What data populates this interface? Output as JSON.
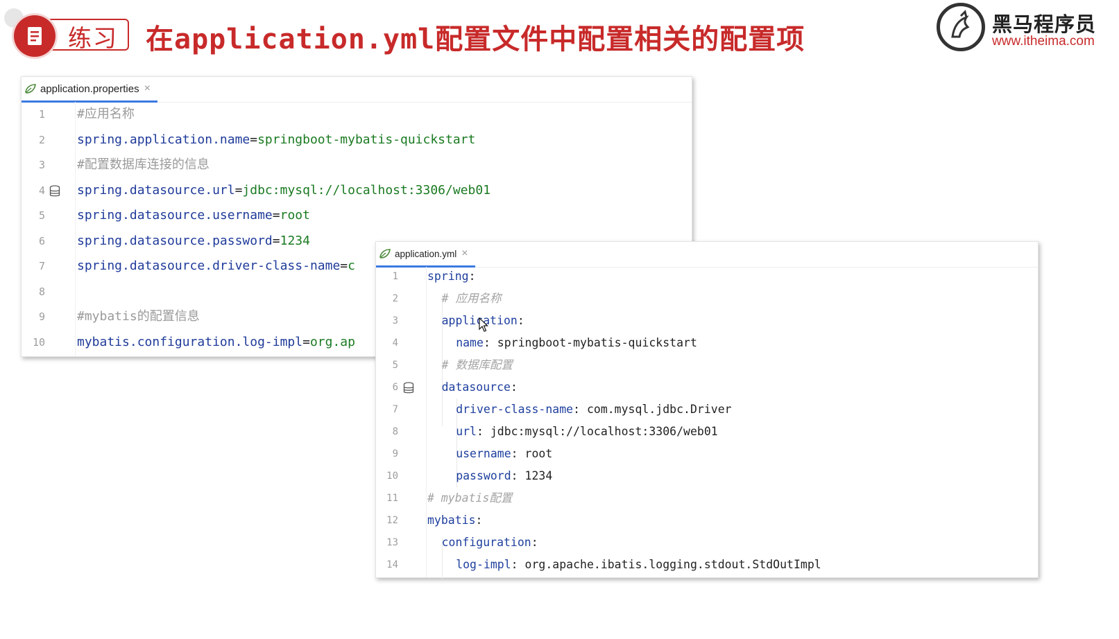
{
  "header": {
    "badge_label": "练习",
    "title": "在application.yml配置文件中配置相关的配置项"
  },
  "logo": {
    "name": "黑马程序员",
    "url": "www.itheima.com"
  },
  "properties_editor": {
    "tab": {
      "label": "application.properties",
      "close": "×"
    },
    "lines": [
      {
        "n": "1",
        "comment": "#应用名称"
      },
      {
        "n": "2",
        "key": "spring.application.name",
        "sep": "=",
        "value": "springboot-mybatis-quickstart"
      },
      {
        "n": "3",
        "comment": "#配置数据库连接的信息"
      },
      {
        "n": "4",
        "key": "spring.datasource.url",
        "sep": "=",
        "value": "jdbc:mysql://localhost:3306/web01"
      },
      {
        "n": "5",
        "key": "spring.datasource.username",
        "sep": "=",
        "value": "root"
      },
      {
        "n": "6",
        "key": "spring.datasource.password",
        "sep": "=",
        "value": "1234"
      },
      {
        "n": "7",
        "key": "spring.datasource.driver-class-name",
        "sep": "=",
        "value": "c"
      },
      {
        "n": "8"
      },
      {
        "n": "9",
        "comment": "#mybatis的配置信息"
      },
      {
        "n": "10",
        "key": "mybatis.configuration.log-impl",
        "sep": "=",
        "value": "org.ap"
      }
    ]
  },
  "yml_editor": {
    "tab": {
      "label": "application.yml",
      "close": "×"
    },
    "lines": [
      {
        "n": "1",
        "key": "spring",
        "sep": ":"
      },
      {
        "n": "2",
        "comment": "# 应用名称"
      },
      {
        "n": "3",
        "key": "application",
        "sep": ":"
      },
      {
        "n": "4",
        "key": "name",
        "sep": ":",
        "value": " springboot-mybatis-quickstart"
      },
      {
        "n": "5",
        "comment": "# 数据库配置"
      },
      {
        "n": "6",
        "key": "datasource",
        "sep": ":"
      },
      {
        "n": "7",
        "key": "driver-class-name",
        "sep": ":",
        "value": " com.mysql.jdbc.Driver"
      },
      {
        "n": "8",
        "key": "url",
        "sep": ":",
        "value": " jdbc:mysql://localhost:3306/web01"
      },
      {
        "n": "9",
        "key": "username",
        "sep": ":",
        "value": " root"
      },
      {
        "n": "10",
        "key": "password",
        "sep": ":",
        "value": " 1234"
      },
      {
        "n": "11",
        "comment": "# mybatis配置"
      },
      {
        "n": "12",
        "key": "mybatis",
        "sep": ":"
      },
      {
        "n": "13",
        "key": "configuration",
        "sep": ":"
      },
      {
        "n": "14",
        "key": "log-impl",
        "sep": ":",
        "value": " org.apache.ibatis.logging.stdout.StdOutImpl"
      }
    ]
  },
  "colors": {
    "accent_red": "#c82a2a",
    "tab_underline": "#3b79e0",
    "key": "#1f3b9a",
    "value_green": "#1a7a21",
    "comment": "#9a9a9a"
  },
  "icons": [
    "document-icon",
    "spring-leaf-icon",
    "database-icon",
    "close-icon",
    "mouse-cursor-icon",
    "horse-logo-icon"
  ]
}
